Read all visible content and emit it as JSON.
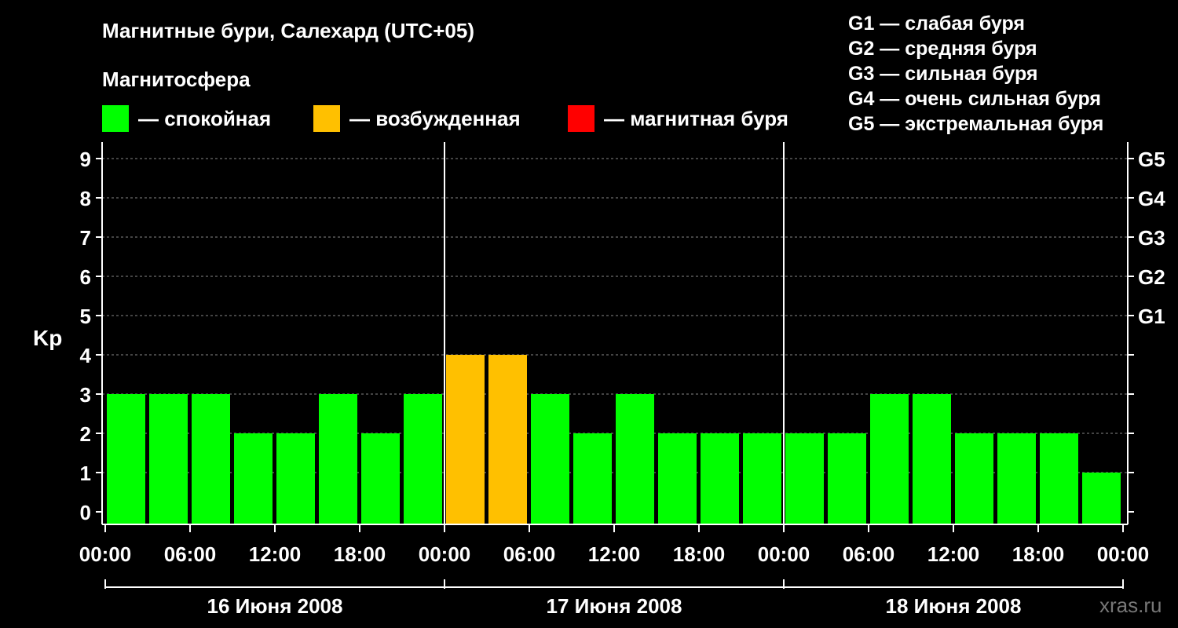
{
  "header": {
    "title": "Магнитные бури, Салехард (UTC+05)",
    "magnetosphere_label": "Магнитосфера"
  },
  "legend": [
    {
      "label": "— спокойная",
      "color": "#00ff00"
    },
    {
      "label": "— возбужденная",
      "color": "#ffc000"
    },
    {
      "label": "— магнитная буря",
      "color": "#ff0000"
    }
  ],
  "storm_legend": [
    "G1 — слабая буря",
    "G2 — средняя буря",
    "G3 — сильная буря",
    "G4 — очень сильная буря",
    "G5 — экстремальная буря"
  ],
  "watermark": "xras.ru",
  "chart_data": {
    "type": "bar",
    "ylabel": "Kp",
    "ylim": [
      0,
      9
    ],
    "y_ticks": [
      0,
      1,
      2,
      3,
      4,
      5,
      6,
      7,
      8,
      9
    ],
    "right_axis_labels": [
      {
        "kp": 5,
        "label": "G1"
      },
      {
        "kp": 6,
        "label": "G2"
      },
      {
        "kp": 7,
        "label": "G3"
      },
      {
        "kp": 8,
        "label": "G4"
      },
      {
        "kp": 9,
        "label": "G5"
      }
    ],
    "x_tick_labels": [
      "00:00",
      "06:00",
      "12:00",
      "18:00",
      "00:00",
      "06:00",
      "12:00",
      "18:00",
      "00:00",
      "06:00",
      "12:00",
      "18:00",
      "00:00"
    ],
    "days": [
      "16 Июня 2008",
      "17 Июня 2008",
      "18 Июня 2008"
    ],
    "interval_hours": 3,
    "values": [
      3,
      3,
      3,
      2,
      2,
      3,
      2,
      3,
      4,
      4,
      3,
      2,
      3,
      2,
      2,
      2,
      2,
      2,
      3,
      3,
      2,
      2,
      2,
      1
    ],
    "colors": {
      "quiet": "#00ff00",
      "active": "#ffc000",
      "storm": "#ff0000"
    },
    "grid": true
  }
}
